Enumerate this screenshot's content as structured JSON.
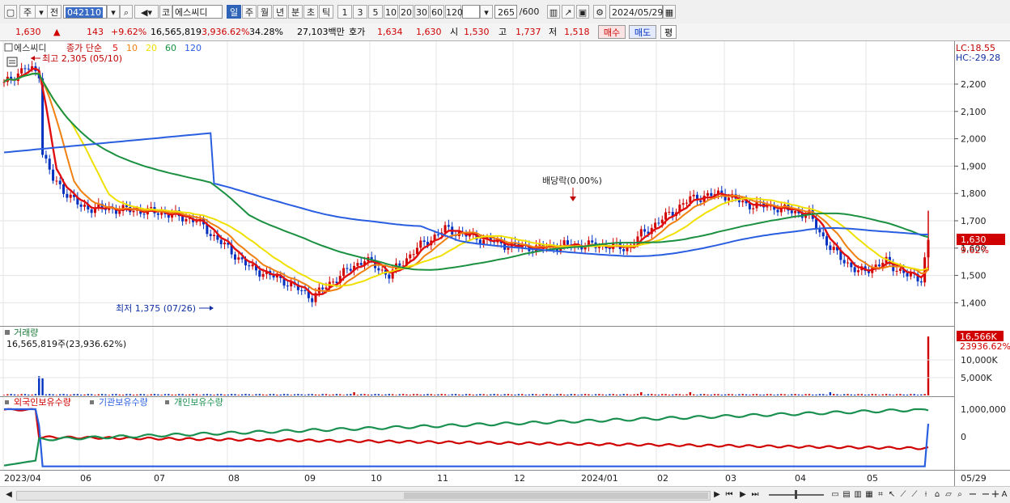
{
  "toolbar": {
    "market": "주",
    "period": "전",
    "code": "042110",
    "exchange_badge": "코",
    "stock_name": "에스씨디",
    "timeframes": [
      "일",
      "주",
      "월",
      "년",
      "분",
      "초",
      "틱"
    ],
    "active_timeframe": "일",
    "intervals": [
      "1",
      "3",
      "5",
      "10",
      "20",
      "30",
      "60",
      "120"
    ],
    "bar_count": "265",
    "bar_total": "/600",
    "date": "2024/05/29"
  },
  "quote": {
    "price": "1,630",
    "change_arrow": "▲",
    "change": "143",
    "change_pct": "+9.62%",
    "volume": "16,565,819",
    "volume_pct": "3,936.62%",
    "turnover": "34.28%",
    "amount": "27,103백만",
    "ask_label": "호가",
    "ask": "1,634",
    "bid": "1,630",
    "open_label": "시",
    "open": "1,530",
    "high_label": "고",
    "high": "1,737",
    "low_label": "저",
    "low": "1,518",
    "buy_btn": "매수",
    "sell_btn": "매도",
    "avg_btn": "평"
  },
  "price_panel": {
    "name": "에스씨디",
    "legend_prefix": "종가 단순",
    "ma_periods": [
      {
        "label": "5",
        "color": "#e01010"
      },
      {
        "label": "10",
        "color": "#f08010"
      },
      {
        "label": "20",
        "color": "#f0e000"
      },
      {
        "label": "60",
        "color": "#1a9040"
      },
      {
        "label": "120",
        "color": "#2a5ee0"
      }
    ],
    "high_annotation": "최고 2,305 (05/10)",
    "low_annotation": "최저 1,375 (07/26)",
    "dividend_annotation": "배당락(0.00%)",
    "lc": "LC:18.55",
    "hc": "HC:-29.28",
    "y_ticks": [
      "2,200",
      "2,100",
      "2,000",
      "1,900",
      "1,800",
      "1,700",
      "1,600",
      "1,500",
      "1,400"
    ],
    "last_price_tag": "1,630",
    "last_pct_tag": "9.62%"
  },
  "volume_panel": {
    "title": "거래량",
    "info": "16,565,819주(23,936.62%)",
    "tag": "16,566K",
    "tag_pct": "23936.62%",
    "y_ticks": [
      "10,000K",
      "5,000K"
    ]
  },
  "holdings_panel": {
    "series": [
      {
        "label": "외국인보유수량",
        "color": "#d00000"
      },
      {
        "label": "기관보유수량",
        "color": "#2a5ee0"
      },
      {
        "label": "개인보유수량",
        "color": "#1a9050"
      }
    ],
    "y_ticks": [
      "1,000,000",
      "0"
    ]
  },
  "x_axis": [
    "2023/04",
    "06",
    "07",
    "08",
    "09",
    "10",
    "11",
    "12",
    "2024/01",
    "02",
    "03",
    "04",
    "05",
    "05/29"
  ],
  "colors": {
    "up": "#d00000",
    "down": "#0030c0",
    "ma5": "#e01010",
    "ma10": "#f08010",
    "ma20": "#f0e000",
    "ma60": "#1a9040",
    "ma120": "#2a5ee0"
  },
  "chart_data": {
    "type": "line",
    "title": "에스씨디",
    "x": [
      "2023/04",
      "06",
      "07",
      "08",
      "09",
      "10",
      "11",
      "12",
      "2024/01",
      "02",
      "03",
      "04",
      "05",
      "05/29"
    ],
    "ylim": [
      1330,
      2330
    ],
    "series": [
      {
        "name": "5",
        "values": [
          2230,
          1900,
          1740,
          1690,
          1450,
          1560,
          1650,
          1620,
          1630,
          1760,
          1800,
          1720,
          1550,
          1540,
          1520,
          1630
        ]
      },
      {
        "name": "60",
        "values": [
          2150,
          2060,
          1900,
          1720,
          1600,
          1580,
          1610,
          1620,
          1660,
          1700,
          1720,
          1700,
          1610,
          1540,
          1520
        ]
      },
      {
        "name": "120",
        "values": [
          1970,
          2020,
          2000,
          1880,
          1780,
          1680,
          1620,
          1610,
          1640,
          1670,
          1650,
          1630,
          1620
        ]
      }
    ]
  }
}
